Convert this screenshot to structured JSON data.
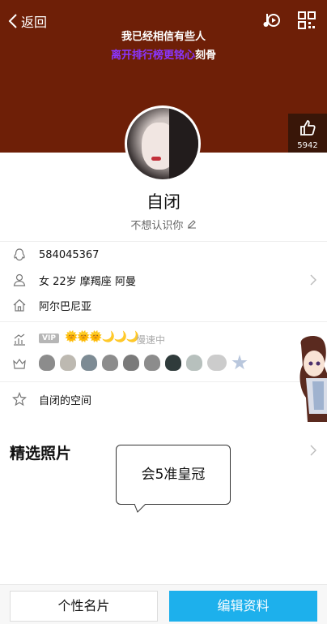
{
  "header": {
    "back_label": "返回",
    "lyric_line1": "我已经相信有些人",
    "lyric_line2_highlight": "离开排行榜更铭心",
    "lyric_line2_rest": "刻骨",
    "icons": [
      "music-icon",
      "qrcode-icon"
    ],
    "like_count": "5942",
    "background_color": "#6e1f07"
  },
  "profile": {
    "nickname": "自闭",
    "signature": "不想认识你"
  },
  "info": {
    "qq_number": "584045367",
    "basic": "女  22岁  摩羯座  阿曼",
    "location": "阿尔巴尼亚"
  },
  "levels": {
    "vip_badge": "VIP",
    "level_icons": "🌞🌞🌞🌙🌙🌙",
    "speed_text": "慢速中"
  },
  "space": {
    "label": "自闭的空间"
  },
  "photos": {
    "title": "精选照片",
    "bubble_text": "会5准皇冠"
  },
  "footer": {
    "card_button": "个性名片",
    "edit_button": "编辑资料",
    "accent_color": "#1db0ec"
  }
}
